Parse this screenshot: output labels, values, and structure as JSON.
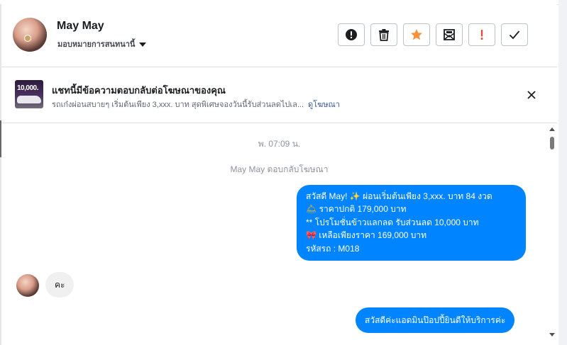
{
  "header": {
    "contact_name": "May May",
    "assign_label": "มอบหมายการสนทนานี้",
    "actions": [
      {
        "icon": "alert-circle-icon",
        "label": "Mark as spam"
      },
      {
        "icon": "trash-icon",
        "label": "Delete"
      },
      {
        "icon": "star-icon",
        "label": "Star",
        "color": "#f7923b"
      },
      {
        "icon": "mark-unread-icon",
        "label": "Mark as unread"
      },
      {
        "icon": "exclamation-icon",
        "label": "Follow up",
        "color": "#dd4b39"
      },
      {
        "icon": "checkmark-icon",
        "label": "Mark as done"
      }
    ]
  },
  "ad_banner": {
    "thumbnail_text": "10,000.",
    "title": "แชทนี้มีข้อความตอบกลับต่อโฆษณาของคุณ",
    "body": "รถเก๋งผ่อนสบายๆ เริ่มต้นเพียง 3,xxx. บาท สุดพิเศษจองวันนี้รับส่วนลดไปเล...",
    "link_label": "ดูโฆษณา"
  },
  "chat": {
    "timestamp": "พ. 07:09 น.",
    "reply_note": "May May ตอบกลับโฆษณา",
    "outgoing_message_1": {
      "lines": [
        {
          "emoji": "",
          "text": "สวัสดี May! "
        },
        {
          "emoji": "🛎",
          "text": " ราคาปกติ 179,000 บาท"
        },
        {
          "emoji": "",
          "text": "** โปรโมชั่นข้าวแลกลด รับส่วนลด 10,000 บาท"
        },
        {
          "emoji": "🎀",
          "text": "  เหลือเพียงราคา 169,000 บาท"
        },
        {
          "emoji": "",
          "text": " รหัสรถ : M018"
        }
      ],
      "line1_emoji": "✨",
      "line1_rest": "  ผ่อนเริ่มต้นเพียง 3,xxx. บาท 84 งวด"
    },
    "incoming_message": "คะ",
    "outgoing_message_2": "สวัสดีค่ะแอดมินป๊อปปี้ยินดีให้บริการค่ะ"
  },
  "colors": {
    "outgoing_bubble": "#0084ff",
    "incoming_bubble": "#f1f0f0",
    "link": "#385898",
    "secondary_text": "#8d949e"
  }
}
